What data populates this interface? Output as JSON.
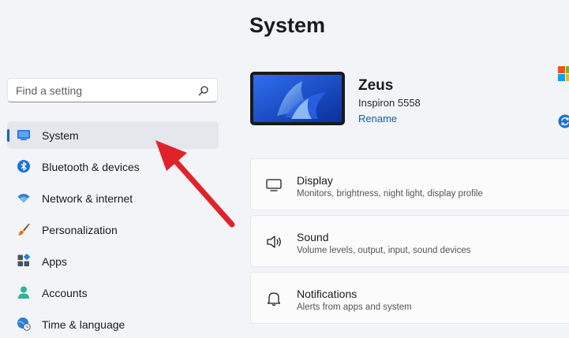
{
  "page": {
    "title": "System"
  },
  "search": {
    "placeholder": "Find a setting"
  },
  "sidebar": {
    "items": [
      {
        "label": "System",
        "icon": "display-icon",
        "active": true
      },
      {
        "label": "Bluetooth & devices",
        "icon": "bluetooth-icon"
      },
      {
        "label": "Network & internet",
        "icon": "wifi-icon"
      },
      {
        "label": "Personalization",
        "icon": "brush-icon"
      },
      {
        "label": "Apps",
        "icon": "apps-icon"
      },
      {
        "label": "Accounts",
        "icon": "person-icon"
      },
      {
        "label": "Time & language",
        "icon": "globe-clock-icon"
      }
    ]
  },
  "device": {
    "name": "Zeus",
    "model": "Inspiron 5558",
    "rename_label": "Rename"
  },
  "cards": [
    {
      "title": "Display",
      "subtitle": "Monitors, brightness, night light, display profile",
      "icon": "monitor-icon"
    },
    {
      "title": "Sound",
      "subtitle": "Volume levels, output, input, sound devices",
      "icon": "speaker-icon"
    },
    {
      "title": "Notifications",
      "subtitle": "Alerts from apps and system",
      "icon": "bell-icon"
    }
  ],
  "colors": {
    "background": "#f3f4f7",
    "accent": "#0067c0",
    "link": "#0f5ea8",
    "annotation_arrow": "#e0232b"
  }
}
